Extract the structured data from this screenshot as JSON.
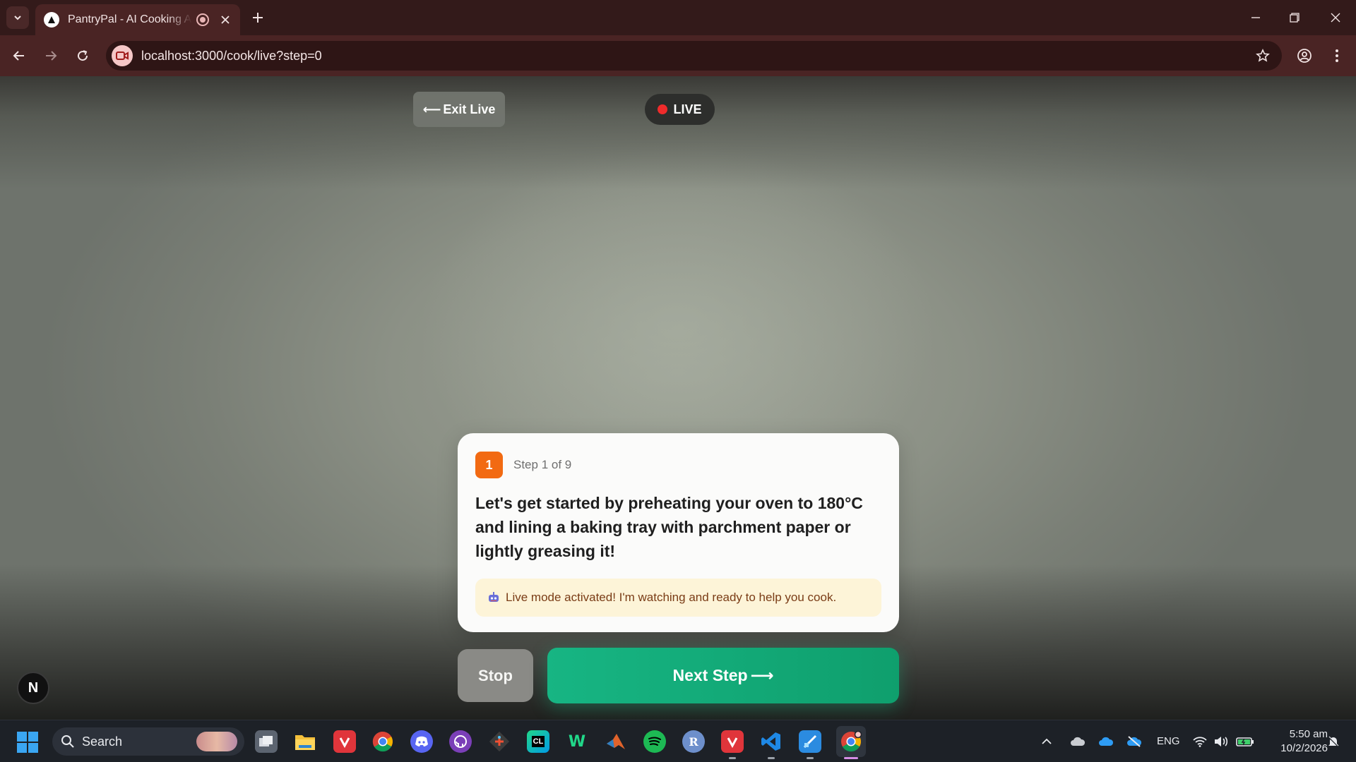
{
  "browser": {
    "tab_title": "PantryPal - AI Cooking Assistant",
    "url": "localhost:3000/cook/live?step=0"
  },
  "page": {
    "exit_label": "Exit Live",
    "live_label": "LIVE",
    "step_number": "1",
    "step_label": "Step 1 of 9",
    "instruction": "Let's get started by preheating your oven to 180°C and lining a baking tray with parchment paper or lightly greasing it!",
    "notice": "Live mode activated! I'm watching and ready to help you cook.",
    "stop_label": "Stop",
    "next_label": "Next Step",
    "badge_letter": "N",
    "colors": {
      "accent_orange": "#f26a12",
      "next_green": "#10b981",
      "live_red": "#ef2b2b",
      "notice_bg": "#fdf4d8"
    }
  },
  "taskbar": {
    "search_placeholder": "Search",
    "language": "ENG",
    "time": "5:50 am",
    "date": "10/2/2026",
    "pinned_icons": [
      "task-view-icon",
      "file-explorer-icon",
      "vivaldi-icon",
      "chrome-icon",
      "discord-icon",
      "github-desktop-icon",
      "git-icon",
      "clion-icon",
      "webstorm-icon",
      "matlab-icon",
      "spotify-icon",
      "r-icon",
      "vivaldi-icon",
      "vscode-icon",
      "snipping-tool-icon",
      "chrome-active-icon"
    ]
  }
}
